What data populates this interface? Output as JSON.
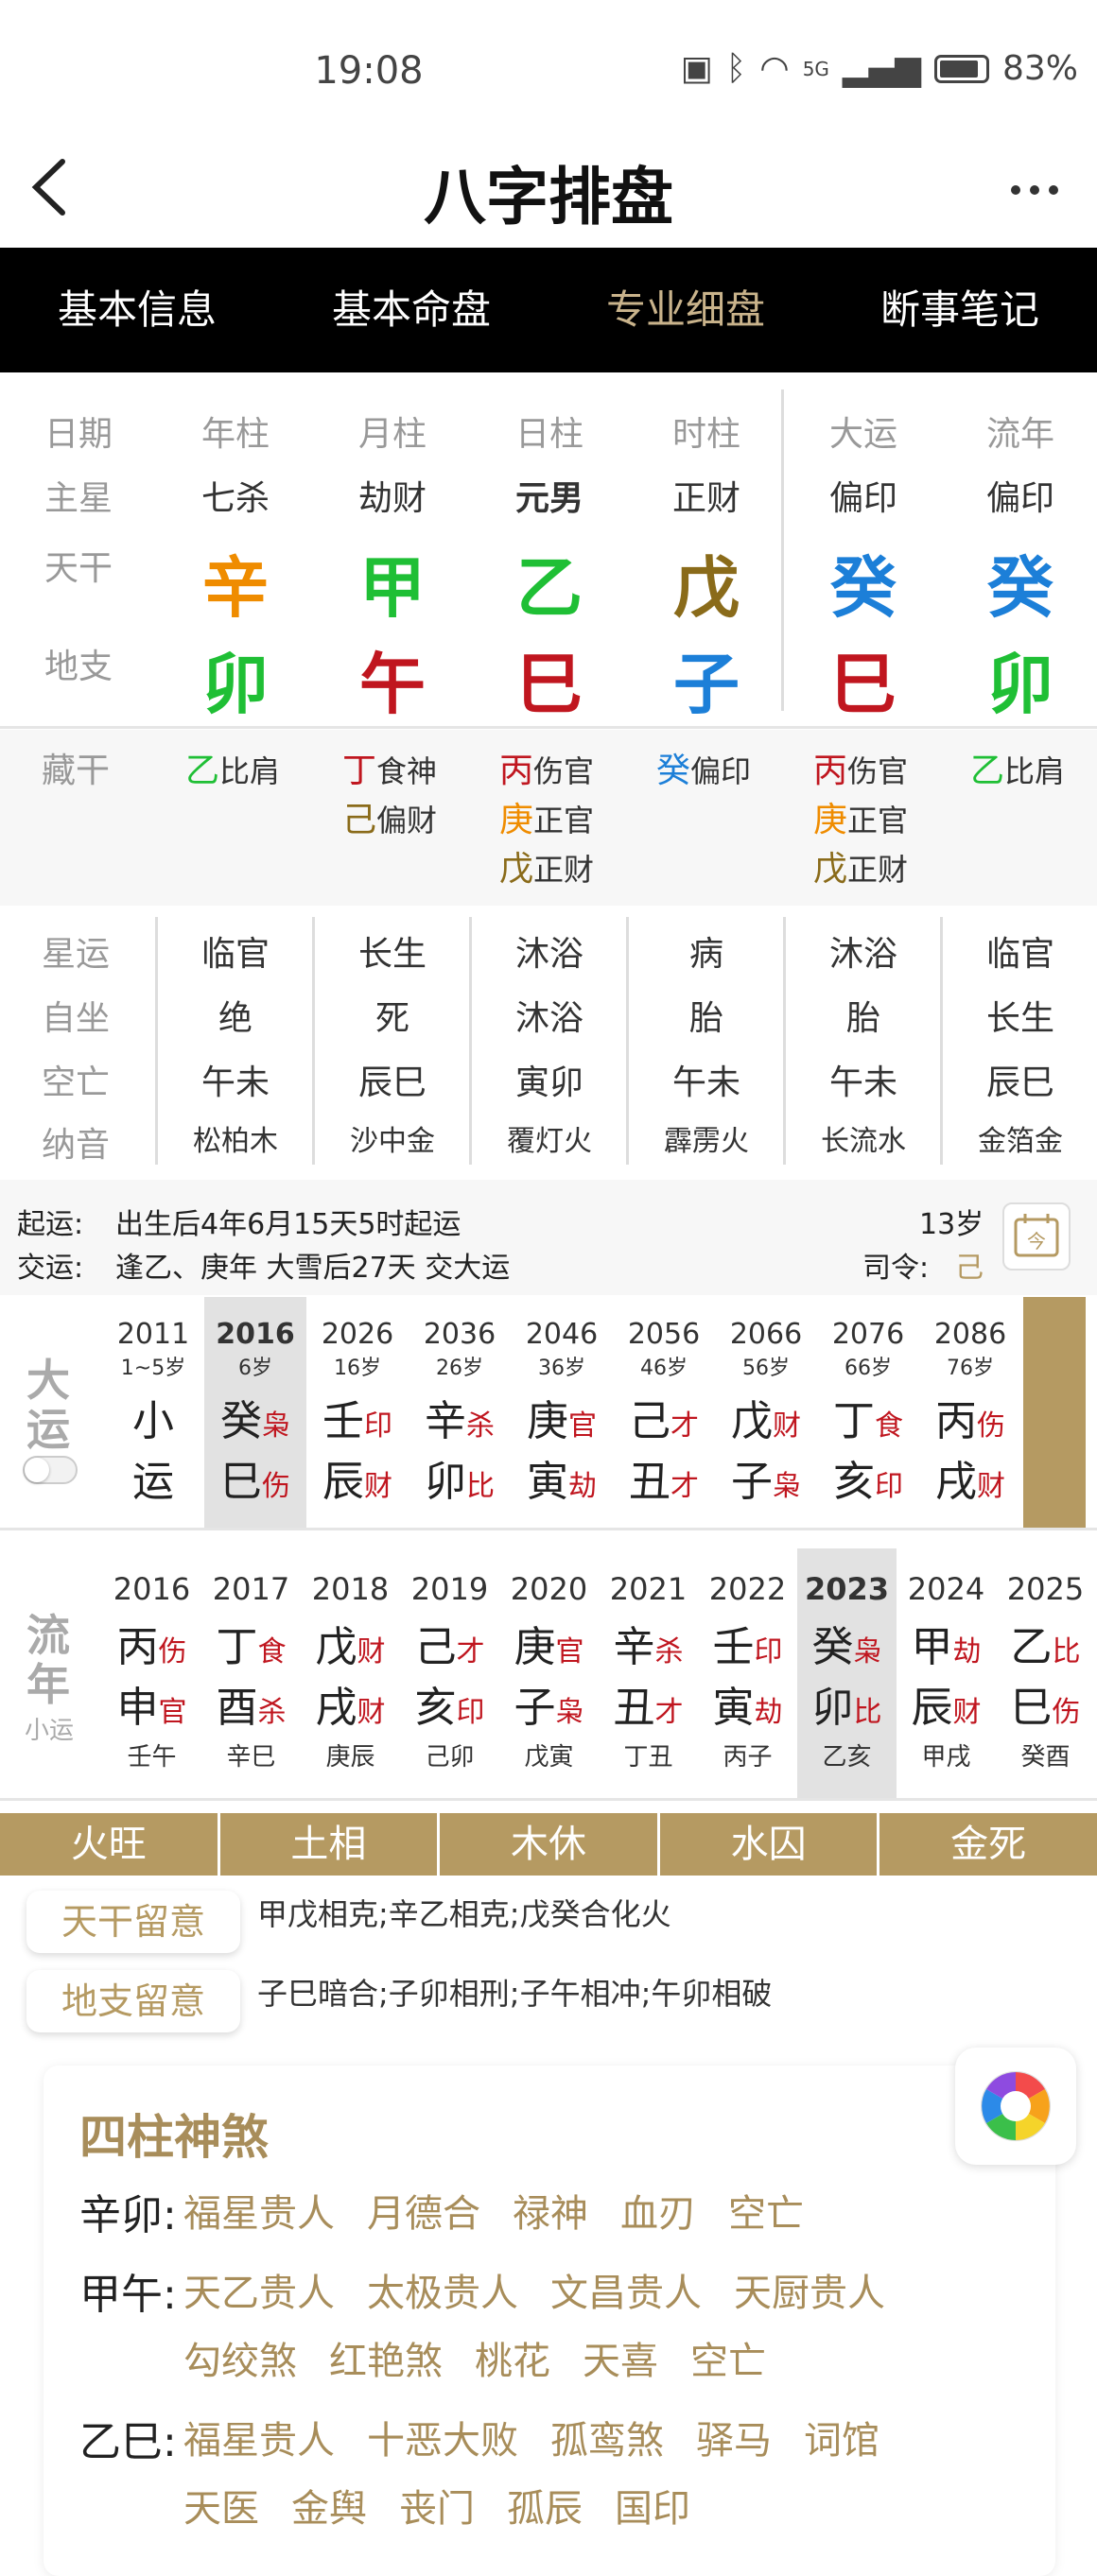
{
  "status": {
    "time": "19:08",
    "battery": "83%",
    "network": "5G"
  },
  "header": {
    "title": "八字排盘",
    "back": "<",
    "more": "···"
  },
  "tabs": [
    "基本信息",
    "基本命盘",
    "专业细盘",
    "断事笔记"
  ],
  "active_tab": 2,
  "pillar_table": {
    "row_labels": {
      "date": "日期",
      "star": "主星",
      "stem": "天干",
      "branch": "地支"
    },
    "columns": [
      {
        "name": "年柱",
        "star": "七杀",
        "stem": "辛",
        "stem_color": "#ef8c00",
        "branch": "卯",
        "branch_color": "#1fbf35"
      },
      {
        "name": "月柱",
        "star": "劫财",
        "stem": "甲",
        "stem_color": "#1fbf35",
        "branch": "午",
        "branch_color": "#c0161f"
      },
      {
        "name": "日柱",
        "star": "元男",
        "stem": "乙",
        "stem_color": "#1fbf35",
        "branch": "巳",
        "branch_color": "#c0161f"
      },
      {
        "name": "时柱",
        "star": "正财",
        "stem": "戊",
        "stem_color": "#8a6b1a",
        "branch": "子",
        "branch_color": "#1c7fd8"
      },
      {
        "name": "大运",
        "star": "偏印",
        "stem": "癸",
        "stem_color": "#1c7fd8",
        "branch": "巳",
        "branch_color": "#c0161f"
      },
      {
        "name": "流年",
        "star": "偏印",
        "stem": "癸",
        "stem_color": "#1c7fd8",
        "branch": "卯",
        "branch_color": "#1fbf35"
      }
    ]
  },
  "hidden_stems": {
    "label": "藏干",
    "columns": [
      [
        {
          "g": "乙",
          "c": "#1fbf35",
          "t": "比肩"
        }
      ],
      [
        {
          "g": "丁",
          "c": "#c0161f",
          "t": "食神"
        },
        {
          "g": "己",
          "c": "#8a6b1a",
          "t": "偏财"
        }
      ],
      [
        {
          "g": "丙",
          "c": "#c0161f",
          "t": "伤官"
        },
        {
          "g": "庚",
          "c": "#ef8c00",
          "t": "正官"
        },
        {
          "g": "戊",
          "c": "#8a6b1a",
          "t": "正财"
        }
      ],
      [
        {
          "g": "癸",
          "c": "#1c7fd8",
          "t": "偏印"
        }
      ],
      [
        {
          "g": "丙",
          "c": "#c0161f",
          "t": "伤官"
        },
        {
          "g": "庚",
          "c": "#ef8c00",
          "t": "正官"
        },
        {
          "g": "戊",
          "c": "#8a6b1a",
          "t": "正财"
        }
      ],
      [
        {
          "g": "乙",
          "c": "#1fbf35",
          "t": "比肩"
        }
      ]
    ]
  },
  "extra_rows": {
    "labels": [
      "星运",
      "自坐",
      "空亡",
      "纳音"
    ],
    "values": [
      [
        "临官",
        "长生",
        "沐浴",
        "病",
        "沐浴",
        "临官"
      ],
      [
        "绝",
        "死",
        "沐浴",
        "胎",
        "胎",
        "长生"
      ],
      [
        "午未",
        "辰巳",
        "寅卯",
        "午未",
        "午未",
        "辰巳"
      ],
      [
        "松柏木",
        "沙中金",
        "覆灯火",
        "霹雳火",
        "长流水",
        "金箔金"
      ]
    ]
  },
  "luck_info": {
    "start_label": "起运:",
    "start_text": "出生后4年6月15天5时起运",
    "change_label": "交运:",
    "change_text": "逢乙、庚年 大雪后27天 交大运",
    "age": "13岁",
    "siling_label": "司令:",
    "siling_value": "己"
  },
  "dayun": {
    "title1": "大",
    "title2": "运",
    "items": [
      {
        "year": "2011",
        "age": "1~5岁",
        "top": "小",
        "top_sub": "",
        "bot": "运",
        "bot_sub": ""
      },
      {
        "year": "2016",
        "age": "6岁",
        "top": "癸",
        "top_sub": "枭",
        "bot": "巳",
        "bot_sub": "伤"
      },
      {
        "year": "2026",
        "age": "16岁",
        "top": "壬",
        "top_sub": "印",
        "bot": "辰",
        "bot_sub": "财"
      },
      {
        "year": "2036",
        "age": "26岁",
        "top": "辛",
        "top_sub": "杀",
        "bot": "卯",
        "bot_sub": "比"
      },
      {
        "year": "2046",
        "age": "36岁",
        "top": "庚",
        "top_sub": "官",
        "bot": "寅",
        "bot_sub": "劫"
      },
      {
        "year": "2056",
        "age": "46岁",
        "top": "己",
        "top_sub": "才",
        "bot": "丑",
        "bot_sub": "才"
      },
      {
        "year": "2066",
        "age": "56岁",
        "top": "戊",
        "top_sub": "财",
        "bot": "子",
        "bot_sub": "枭"
      },
      {
        "year": "2076",
        "age": "66岁",
        "top": "丁",
        "top_sub": "食",
        "bot": "亥",
        "bot_sub": "印"
      },
      {
        "year": "2086",
        "age": "76岁",
        "top": "丙",
        "top_sub": "伤",
        "bot": "戌",
        "bot_sub": "财"
      }
    ],
    "selected": 1
  },
  "liunian": {
    "title1": "流",
    "title2": "年",
    "title3": "小运",
    "items": [
      {
        "year": "2016",
        "top": "丙",
        "top_sub": "伤",
        "bot": "申",
        "bot_sub": "官",
        "xy": "壬午"
      },
      {
        "year": "2017",
        "top": "丁",
        "top_sub": "食",
        "bot": "酉",
        "bot_sub": "杀",
        "xy": "辛巳"
      },
      {
        "year": "2018",
        "top": "戊",
        "top_sub": "财",
        "bot": "戌",
        "bot_sub": "财",
        "xy": "庚辰"
      },
      {
        "year": "2019",
        "top": "己",
        "top_sub": "才",
        "bot": "亥",
        "bot_sub": "印",
        "xy": "己卯"
      },
      {
        "year": "2020",
        "top": "庚",
        "top_sub": "官",
        "bot": "子",
        "bot_sub": "枭",
        "xy": "戊寅"
      },
      {
        "year": "2021",
        "top": "辛",
        "top_sub": "杀",
        "bot": "丑",
        "bot_sub": "才",
        "xy": "丁丑"
      },
      {
        "year": "2022",
        "top": "壬",
        "top_sub": "印",
        "bot": "寅",
        "bot_sub": "劫",
        "xy": "丙子"
      },
      {
        "year": "2023",
        "top": "癸",
        "top_sub": "枭",
        "bot": "卯",
        "bot_sub": "比",
        "xy": "乙亥"
      },
      {
        "year": "2024",
        "top": "甲",
        "top_sub": "劫",
        "bot": "辰",
        "bot_sub": "财",
        "xy": "甲戌"
      },
      {
        "year": "2025",
        "top": "乙",
        "top_sub": "比",
        "bot": "巳",
        "bot_sub": "伤",
        "xy": "癸酉"
      }
    ],
    "selected": 7
  },
  "elements": [
    "火旺",
    "土相",
    "木休",
    "水囚",
    "金死"
  ],
  "notices": {
    "stem_label": "天干留意",
    "stem_text": "甲戊相克;辛乙相克;戊癸合化火",
    "branch_label": "地支留意",
    "branch_text": "子巳暗合;子卯相刑;子午相冲;午卯相破"
  },
  "shensha": {
    "title": "四柱神煞",
    "rows": [
      {
        "pillar": "辛卯:",
        "items": [
          "福星贵人",
          "月德合",
          "禄神",
          "血刃",
          "空亡"
        ]
      },
      {
        "pillar": "甲午:",
        "items": [
          "天乙贵人",
          "太极贵人",
          "文昌贵人",
          "天厨贵人",
          "勾绞煞",
          "红艳煞",
          "桃花",
          "天喜",
          "空亡"
        ]
      },
      {
        "pillar": "乙巳:",
        "items": [
          "福星贵人",
          "十恶大败",
          "孤鸾煞",
          "驿马",
          "词馆",
          "天医",
          "金舆",
          "丧门",
          "孤辰",
          "国印"
        ]
      }
    ]
  },
  "colors": {
    "accent": "#b59a62",
    "gold_text": "#a88d5a",
    "red": "#c0161f",
    "green": "#1fbf35",
    "blue": "#1c7fd8",
    "orange": "#ef8c00",
    "brown": "#8a6b1a"
  }
}
